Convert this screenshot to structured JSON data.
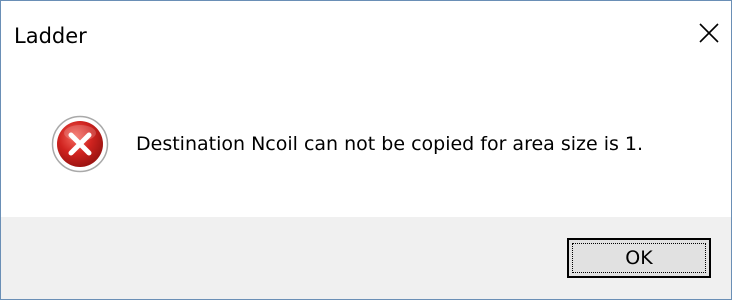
{
  "window": {
    "title": "Ladder",
    "close_icon": "close-icon"
  },
  "message": {
    "icon": "error-icon",
    "text": "Destination Ncoil can not be copied for area size is 1."
  },
  "buttons": {
    "ok_label": "OK"
  },
  "colors": {
    "border": "#6a8fb6",
    "footer": "#f0f0f0",
    "button_face": "#e1e1e1",
    "error_red": "#d0231f"
  }
}
